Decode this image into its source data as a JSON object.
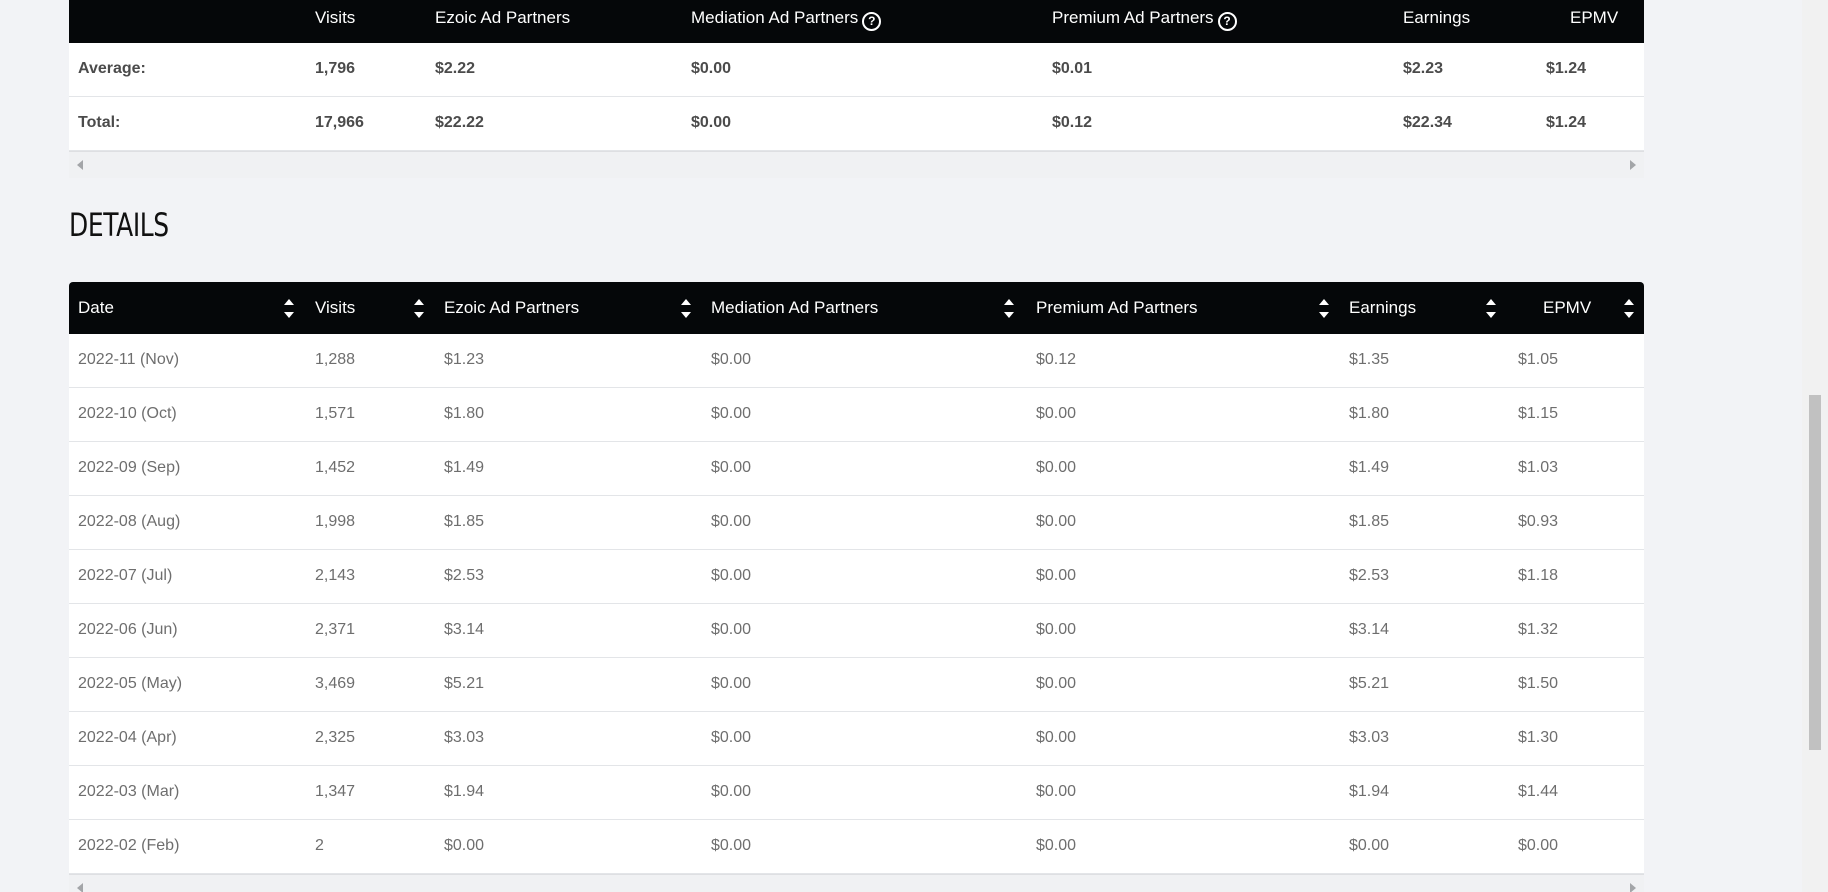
{
  "summary": {
    "headers": [
      "",
      "Visits",
      "Ezoic Ad Partners",
      "Mediation Ad Partners",
      "Premium Ad Partners",
      "Earnings",
      "EPMV"
    ],
    "help_icon": "?",
    "rows": [
      [
        "Average:",
        "1,796",
        "$2.22",
        "$0.00",
        "$0.01",
        "$2.23",
        "$1.24"
      ],
      [
        "Total:",
        "17,966",
        "$22.22",
        "$0.00",
        "$0.12",
        "$22.34",
        "$1.24"
      ]
    ]
  },
  "details": {
    "title": "DETAILS",
    "headers": [
      "Date",
      "Visits",
      "Ezoic Ad Partners",
      "Mediation Ad Partners",
      "Premium Ad Partners",
      "Earnings",
      "EPMV"
    ],
    "rows": [
      [
        "2022-11 (Nov)",
        "1,288",
        "$1.23",
        "$0.00",
        "$0.12",
        "$1.35",
        "$1.05"
      ],
      [
        "2022-10 (Oct)",
        "1,571",
        "$1.80",
        "$0.00",
        "$0.00",
        "$1.80",
        "$1.15"
      ],
      [
        "2022-09 (Sep)",
        "1,452",
        "$1.49",
        "$0.00",
        "$0.00",
        "$1.49",
        "$1.03"
      ],
      [
        "2022-08 (Aug)",
        "1,998",
        "$1.85",
        "$0.00",
        "$0.00",
        "$1.85",
        "$0.93"
      ],
      [
        "2022-07 (Jul)",
        "2,143",
        "$2.53",
        "$0.00",
        "$0.00",
        "$2.53",
        "$1.18"
      ],
      [
        "2022-06 (Jun)",
        "2,371",
        "$3.14",
        "$0.00",
        "$0.00",
        "$3.14",
        "$1.32"
      ],
      [
        "2022-05 (May)",
        "3,469",
        "$5.21",
        "$0.00",
        "$0.00",
        "$5.21",
        "$1.50"
      ],
      [
        "2022-04 (Apr)",
        "2,325",
        "$3.03",
        "$0.00",
        "$0.00",
        "$3.03",
        "$1.30"
      ],
      [
        "2022-03 (Mar)",
        "1,347",
        "$1.94",
        "$0.00",
        "$0.00",
        "$1.94",
        "$1.44"
      ],
      [
        "2022-02 (Feb)",
        "2",
        "$0.00",
        "$0.00",
        "$0.00",
        "$0.00",
        "$0.00"
      ]
    ]
  }
}
